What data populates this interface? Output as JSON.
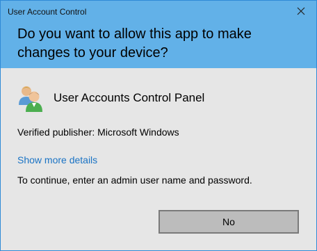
{
  "window": {
    "title": "User Account Control",
    "close_icon": "close-icon"
  },
  "header": {
    "question": "Do you want to allow this app to make changes to your device?",
    "background_color": "#62b1e8"
  },
  "app": {
    "name": "User Accounts Control Panel",
    "icon": "user-accounts-icon"
  },
  "details": {
    "publisher": "Verified publisher: Microsoft Windows",
    "show_more_link": "Show more details",
    "instruction": "To continue, enter an admin user name and password.",
    "link_color": "#1a73c4"
  },
  "buttons": {
    "no_label": "No"
  }
}
